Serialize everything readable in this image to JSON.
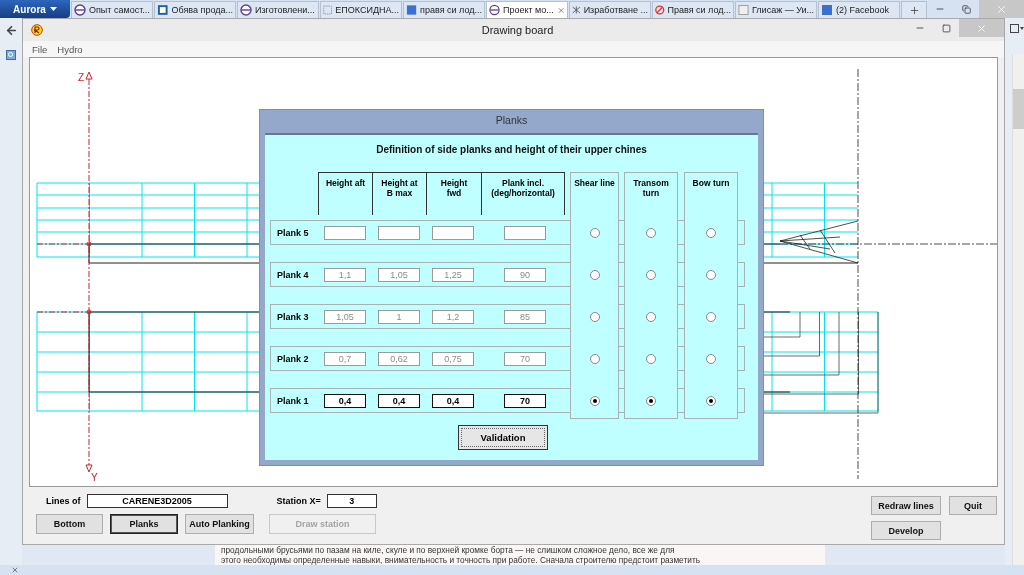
{
  "browser": {
    "menu_button": "Aurora",
    "tabs": [
      {
        "title": "Опыт самост...",
        "selected": false
      },
      {
        "title": "Обява прода...",
        "selected": false
      },
      {
        "title": "Изготовлени...",
        "selected": false
      },
      {
        "title": "ЕПОКСИДНА...",
        "selected": false
      },
      {
        "title": "правя си лод...",
        "selected": false
      },
      {
        "title": "Проект мо...",
        "selected": true
      },
      {
        "title": "Изработване ...",
        "selected": false
      },
      {
        "title": "Правя си лод...",
        "selected": false
      },
      {
        "title": "Глисаж — Уи...",
        "selected": false
      },
      {
        "title": "(2) Facebook",
        "selected": false
      }
    ],
    "page_text": [
      "продольными брусьями по пазам на киле, скуле и по верхней кромке борта — не слишком сложное дело, все же для",
      "этого необходимы определенные навыки, внимательность и точность при работе. Сначала строителю предстоит разметить"
    ]
  },
  "app": {
    "title": "Drawing board",
    "menu": [
      "File",
      "Hydro"
    ],
    "axes": {
      "z": "Z",
      "y": "Y"
    },
    "dialog": {
      "title": "Planks",
      "heading": "Definition of side planks and height of their upper chines",
      "columns": [
        "Height aft",
        "Height at B max",
        "Height fwd",
        "Plank incl. (deg/horizontal)"
      ],
      "rows": [
        {
          "label": "Plank 5",
          "disabled": true
        },
        {
          "label": "Plank 4",
          "disabled": true,
          "values": [
            "1,1",
            "1,05",
            "1,25",
            "90"
          ]
        },
        {
          "label": "Plank 3",
          "disabled": true,
          "values": [
            "1,05",
            "1",
            "1,2",
            "85"
          ]
        },
        {
          "label": "Plank 2",
          "disabled": true,
          "values": [
            "0,7",
            "0,62",
            "0,75",
            "70"
          ]
        },
        {
          "label": "Plank 1",
          "disabled": false,
          "values": [
            "0,4",
            "0,4",
            "0,4",
            "70"
          ]
        }
      ],
      "radio_columns": [
        {
          "label": "Shear line",
          "options": [
            {
              "selected": false
            },
            {
              "selected": false
            },
            {
              "selected": false
            },
            {
              "selected": false
            },
            {
              "selected": true
            }
          ]
        },
        {
          "label": "Transom turn",
          "options": [
            {
              "selected": false
            },
            {
              "selected": false
            },
            {
              "selected": false
            },
            {
              "selected": false
            },
            {
              "selected": true
            }
          ]
        },
        {
          "label": "Bow turn",
          "options": [
            {
              "selected": false
            },
            {
              "selected": false
            },
            {
              "selected": false
            },
            {
              "selected": false
            },
            {
              "selected": true
            }
          ]
        }
      ],
      "validate_button": "Validation"
    },
    "lines_of": {
      "label": "Lines of",
      "value": "CARENE3D2005"
    },
    "station": {
      "label": "Station X=",
      "value": "3"
    },
    "buttons": [
      {
        "label": "Bottom",
        "selected": false,
        "disabled": false
      },
      {
        "label": "Planks",
        "selected": true,
        "disabled": false
      },
      {
        "label": "Auto Planking",
        "selected": false,
        "disabled": false
      },
      {
        "label": "Draw station",
        "selected": false,
        "disabled": true
      }
    ],
    "right_buttons": [
      "Redraw lines",
      "Quit",
      "Develop"
    ]
  }
}
